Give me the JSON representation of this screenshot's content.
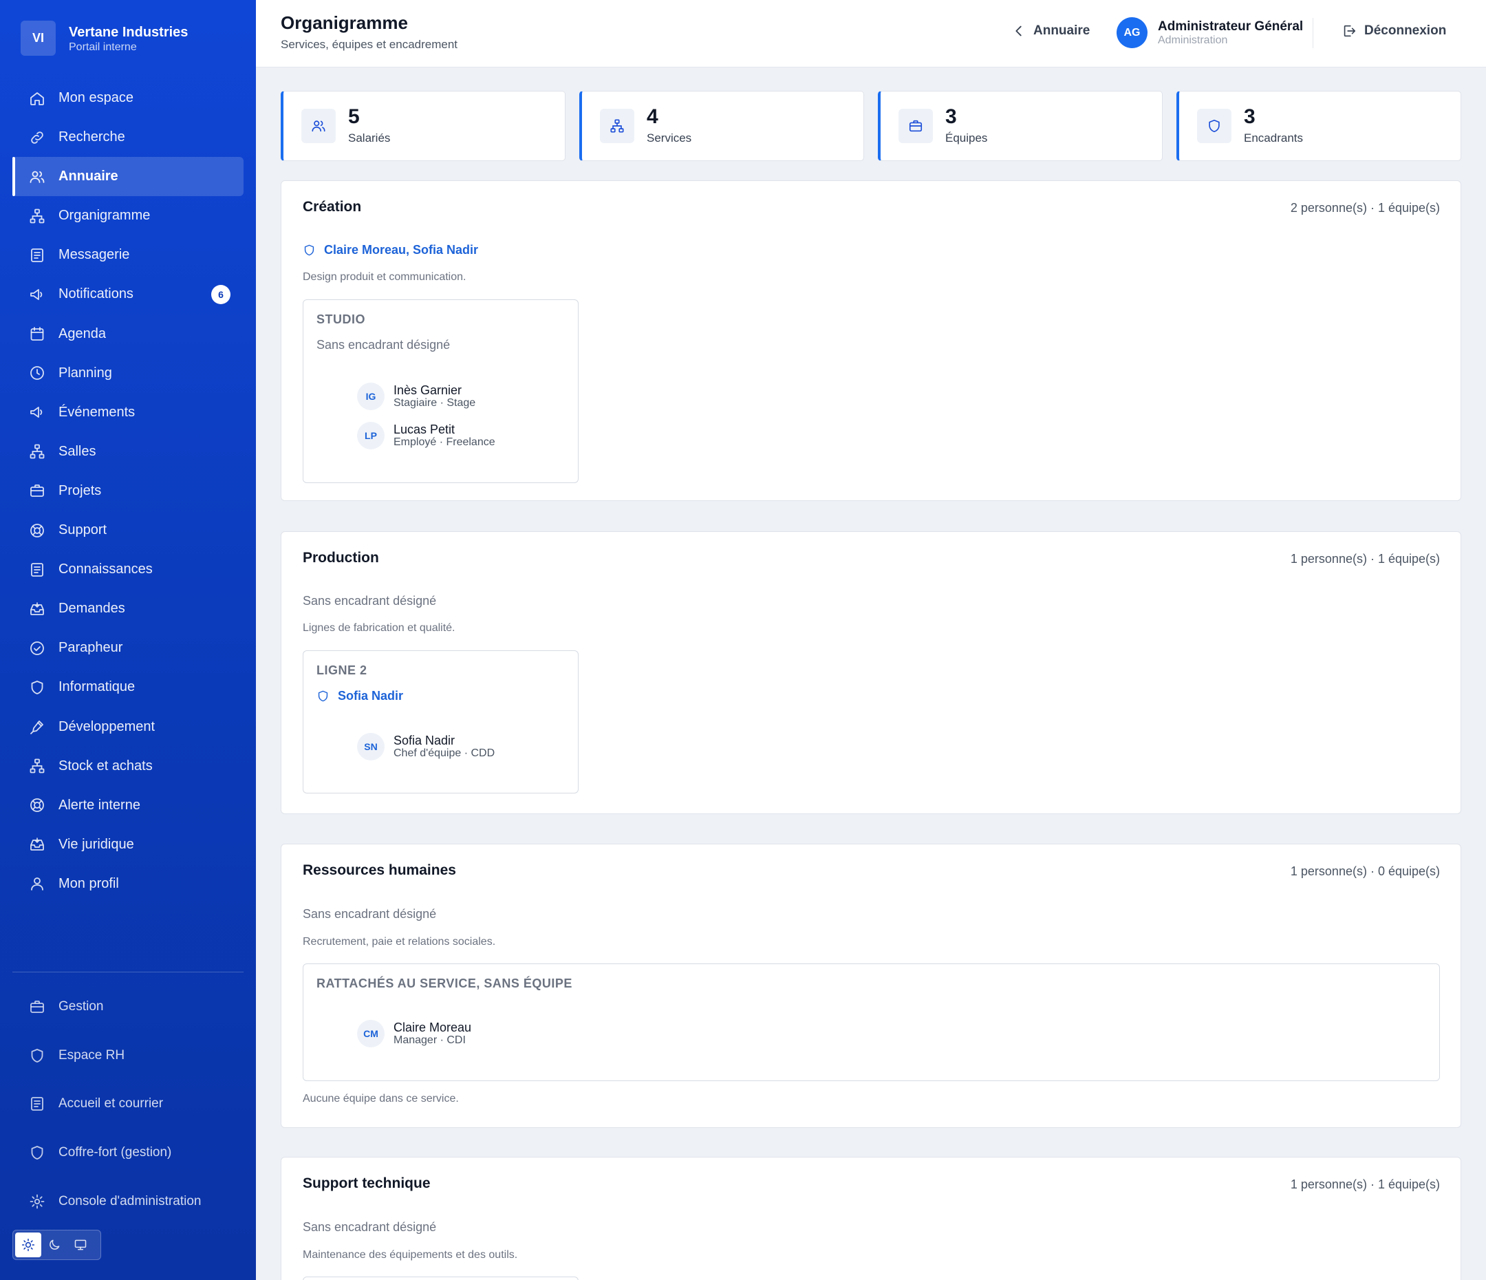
{
  "brand": {
    "initials": "VI",
    "name": "Vertane Industries",
    "subtitle": "Portail interne"
  },
  "sidebar": {
    "items": [
      {
        "label": "Mon espace",
        "icon": "home-icon"
      },
      {
        "label": "Recherche",
        "icon": "link-icon"
      },
      {
        "label": "Annuaire",
        "icon": "users-icon",
        "active": true
      },
      {
        "label": "Organigramme",
        "icon": "org-chart-icon"
      },
      {
        "label": "Messagerie",
        "icon": "document-icon"
      },
      {
        "label": "Notifications",
        "icon": "megaphone-icon",
        "badge": "6"
      },
      {
        "label": "Agenda",
        "icon": "calendar-icon"
      },
      {
        "label": "Planning",
        "icon": "clock-icon"
      },
      {
        "label": "Événements",
        "icon": "megaphone-icon"
      },
      {
        "label": "Salles",
        "icon": "org-chart-icon"
      },
      {
        "label": "Projets",
        "icon": "briefcase-icon"
      },
      {
        "label": "Support",
        "icon": "lifebuoy-icon"
      },
      {
        "label": "Connaissances",
        "icon": "document-icon"
      },
      {
        "label": "Demandes",
        "icon": "inbox-icon"
      },
      {
        "label": "Parapheur",
        "icon": "check-circle-icon"
      },
      {
        "label": "Informatique",
        "icon": "shield-icon"
      },
      {
        "label": "Développement",
        "icon": "pen-icon"
      },
      {
        "label": "Stock et achats",
        "icon": "org-chart-icon"
      },
      {
        "label": "Alerte interne",
        "icon": "lifebuoy-icon"
      },
      {
        "label": "Vie juridique",
        "icon": "inbox-icon"
      },
      {
        "label": "Mon profil",
        "icon": "user-icon"
      }
    ],
    "bottom_items": [
      {
        "label": "Gestion",
        "icon": "briefcase-icon"
      },
      {
        "label": "Espace RH",
        "icon": "shield-icon"
      },
      {
        "label": "Accueil et courrier",
        "icon": "document-icon"
      },
      {
        "label": "Coffre-fort (gestion)",
        "icon": "shield-icon"
      },
      {
        "label": "Console d'administration",
        "icon": "gear-icon"
      }
    ],
    "theme_options": [
      "sun-icon",
      "moon-icon",
      "monitor-icon"
    ],
    "theme_selected": "sun-icon"
  },
  "header": {
    "title": "Organigramme",
    "subtitle": "Services, équipes et encadrement",
    "back_label": "Annuaire",
    "user_initials": "AG",
    "user_name": "Administrateur Général",
    "user_role": "Administration",
    "logout_label": "Déconnexion"
  },
  "stats": [
    {
      "value": "5",
      "label": "Salariés",
      "icon": "users-icon"
    },
    {
      "value": "4",
      "label": "Services",
      "icon": "org-chart-icon"
    },
    {
      "value": "3",
      "label": "Équipes",
      "icon": "briefcase-icon"
    },
    {
      "value": "3",
      "label": "Encadrants",
      "icon": "shield-icon"
    }
  ],
  "sections": [
    {
      "title": "Création",
      "meta": "2 personne(s) · 1 équipe(s)",
      "managers": "Claire Moreau, Sofia Nadir",
      "description": "Design produit et communication.",
      "teams": [
        {
          "name": "STUDIO",
          "no_manager": "Sans encadrant désigné",
          "members": [
            {
              "initials": "IG",
              "name": "Inès Garnier",
              "role": "Stagiaire · Stage"
            },
            {
              "initials": "LP",
              "name": "Lucas Petit",
              "role": "Employé · Freelance"
            }
          ]
        }
      ]
    },
    {
      "title": "Production",
      "meta": "1 personne(s) · 1 équipe(s)",
      "no_manager": "Sans encadrant désigné",
      "description": "Lignes de fabrication et qualité.",
      "teams": [
        {
          "name": "LIGNE 2",
          "manager": "Sofia Nadir",
          "members": [
            {
              "initials": "SN",
              "name": "Sofia Nadir",
              "role": "Chef d'équipe · CDD"
            }
          ]
        }
      ]
    },
    {
      "title": "Ressources humaines",
      "meta": "1 personne(s) · 0 équipe(s)",
      "no_manager": "Sans encadrant désigné",
      "description": "Recrutement, paie et relations sociales.",
      "unassigned": {
        "name": "RATTACHÉS AU SERVICE, SANS ÉQUIPE",
        "members": [
          {
            "initials": "CM",
            "name": "Claire Moreau",
            "role": "Manager · CDI"
          }
        ]
      },
      "no_team_note": "Aucune équipe dans ce service."
    },
    {
      "title": "Support technique",
      "meta": "1 personne(s) · 1 équipe(s)",
      "no_manager": "Sans encadrant désigné",
      "description": "Maintenance des équipements et des outils."
    }
  ],
  "colors": {
    "sidebar": "#0b3ab8",
    "accent": "#1a6df0",
    "link": "#1d63d8"
  }
}
